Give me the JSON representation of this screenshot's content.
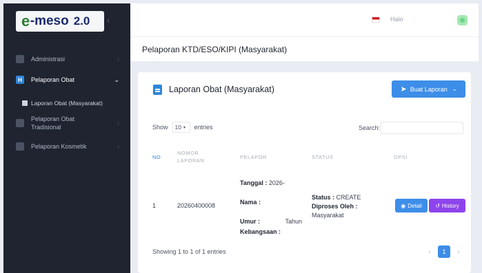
{
  "app": {
    "logo_e": "e",
    "logo_rest": "-meso",
    "logo_version": "2.0"
  },
  "sidebar": {
    "items": [
      {
        "label": "Administrasi",
        "icon": "folder-icon"
      },
      {
        "label": "Pelaporan Obat",
        "icon": "h-icon"
      },
      {
        "label": "Pelaporan Obat Tradisional",
        "icon": "briefcase-icon"
      },
      {
        "label": "Pelaporan Kosmetik",
        "icon": "box-icon"
      }
    ],
    "sub_item": "Laporan Obat (Masyarakat)"
  },
  "topbar": {
    "greeting": "Halo",
    "flag_colors": [
      "#d81f26",
      "#ffffff"
    ]
  },
  "page": {
    "title": "Pelaporan KTD/ESO/KIPI (Masyarakat)"
  },
  "card": {
    "title": "Laporan Obat (Masyarakat)",
    "create_button": "Buat Laporan"
  },
  "table_controls": {
    "show_label": "Show",
    "entries_value": "10",
    "entries_label": "entries",
    "search_label": "Search:"
  },
  "table": {
    "headers": {
      "no": "NO",
      "nomor_laporan": "NOMOR LAPORAN",
      "pelapor": "PELAPOR",
      "status": "STATUS",
      "opsi": "OPSI"
    },
    "rows": [
      {
        "no": "1",
        "nomor_laporan": "20260400008",
        "tanggal_label": "Tanggal :",
        "tanggal_value": "2026-",
        "nama_label": "Nama :",
        "umur_label": "Umur :",
        "umur_value": "Tahun",
        "kebangsaan_label": "Kebangsaan :",
        "status_label": "Status :",
        "status_value": "CREATE",
        "diproses_label": "Diproses Oleh :",
        "diproses_value": "Masyarakat",
        "detail_button": "Detail",
        "history_button": "History"
      }
    ]
  },
  "footer": {
    "info": "Showing 1 to 1 of 1 entries",
    "current_page": "1",
    "prev": "‹",
    "next": "›"
  },
  "colors": {
    "sidebar_bg": "#1f2430",
    "primary": "#3d8ee8",
    "history": "#8e44ec"
  }
}
